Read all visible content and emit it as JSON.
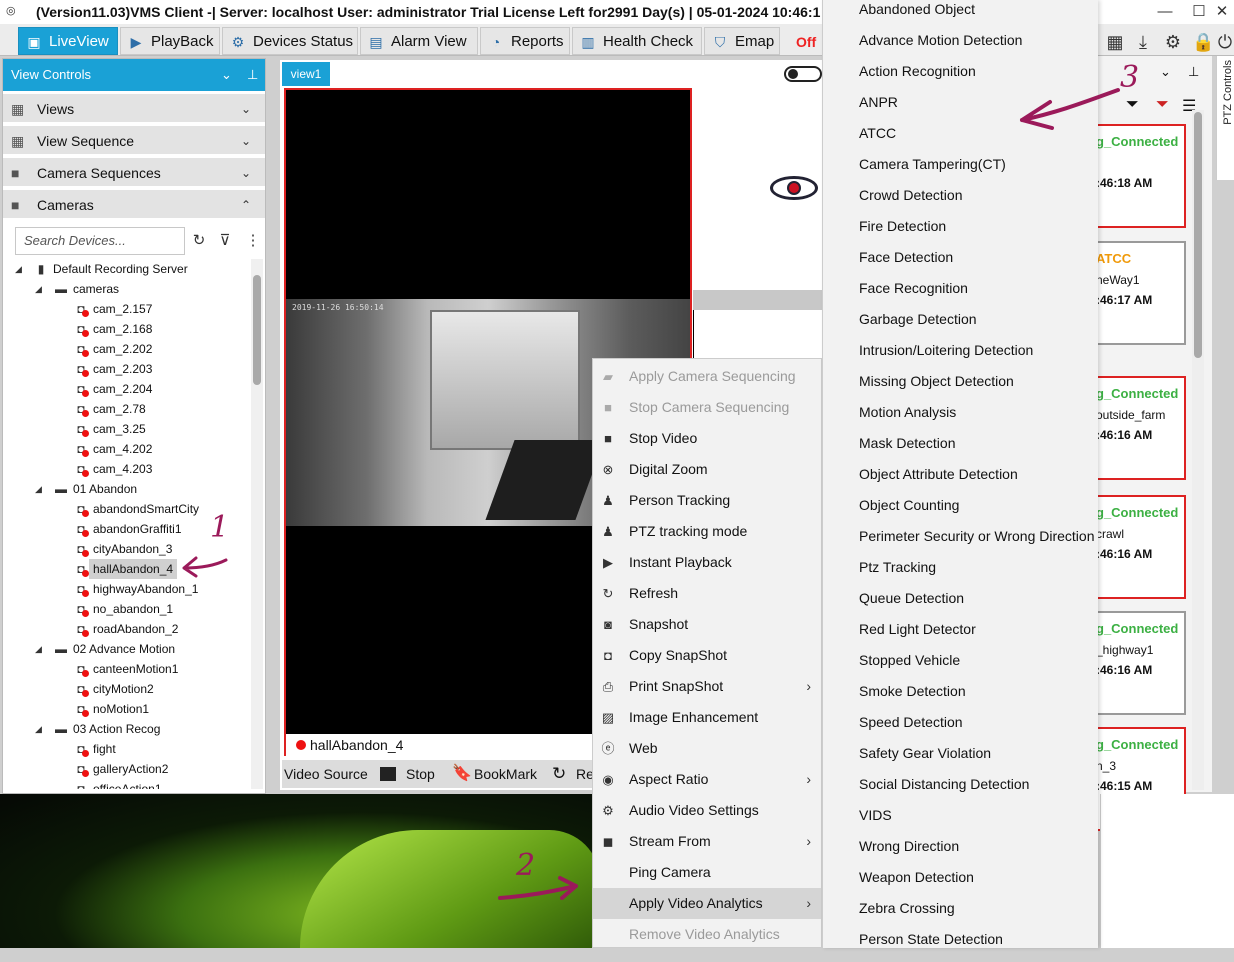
{
  "titlebar": {
    "title": "(Version11.03)VMS Client -| Server: localhost  User: administrator  Trial License Left for2991 Day(s) | 05-01-2024 10:46:1",
    "minimize": "—",
    "maximize": "☐",
    "close": "✕"
  },
  "tabs": [
    {
      "label": "LiveView"
    },
    {
      "label": "PlayBack"
    },
    {
      "label": "Devices Status"
    },
    {
      "label": "Alarm View"
    },
    {
      "label": "Reports"
    },
    {
      "label": "Health Check"
    },
    {
      "label": "Emap"
    }
  ],
  "offline_label": "Off",
  "left_panel": {
    "header": "View Controls",
    "pin": "⊥",
    "accordions": [
      {
        "label": "Views",
        "chevron": "⌄"
      },
      {
        "label": "View Sequence",
        "chevron": "⌄"
      },
      {
        "label": "Camera Sequences",
        "chevron": "⌄"
      },
      {
        "label": "Cameras",
        "chevron": "⌃"
      }
    ],
    "search_placeholder": "Search Devices...",
    "tree": {
      "server": "Default Recording Server",
      "groups": [
        {
          "label": "cameras",
          "items": [
            "cam_2.157",
            "cam_2.168",
            "cam_2.202",
            "cam_2.203",
            "cam_2.204",
            "cam_2.78",
            "cam_3.25",
            "cam_4.202",
            "cam_4.203"
          ]
        },
        {
          "label": "01 Abandon",
          "items": [
            "abandondSmartCity",
            "abandonGraffiti1",
            "cityAbandon_3",
            "hallAbandon_4",
            "highwayAbandon_1",
            "no_abandon_1",
            "roadAbandon_2"
          ]
        },
        {
          "label": "02 Advance Motion",
          "items": [
            "canteenMotion1",
            "cityMotion2",
            "noMotion1"
          ]
        },
        {
          "label": "03 Action Recog",
          "items": [
            "fight",
            "galleryAction2",
            "officeAction1"
          ]
        }
      ],
      "selected": "hallAbandon_4"
    }
  },
  "center": {
    "view_tab": "view1",
    "camera_label": "hallAbandon_4",
    "timestamp": "2019-11-26 16:50:14",
    "video_bar": {
      "source": "Video Source",
      "stop": "Stop",
      "bookmark": "BookMark",
      "re": "Re"
    }
  },
  "context_menu": [
    {
      "label": "Apply Camera Sequencing",
      "icon": "camera-sequence-icon",
      "disabled": true
    },
    {
      "label": "Stop Camera Sequencing",
      "icon": "stop-square-icon",
      "disabled": true
    },
    {
      "label": "Stop Video",
      "icon": "stop-square-icon"
    },
    {
      "label": "Digital Zoom",
      "icon": "zoom-icon"
    },
    {
      "label": "Person Tracking",
      "icon": "person-search-icon"
    },
    {
      "label": "PTZ tracking mode",
      "icon": "person-search-icon"
    },
    {
      "label": "Instant Playback",
      "icon": "play-icon"
    },
    {
      "label": "Refresh",
      "icon": "refresh-icon"
    },
    {
      "label": "Snapshot",
      "icon": "camera-icon"
    },
    {
      "label": "Copy SnapShot",
      "icon": "copy-camera-icon"
    },
    {
      "label": "Print SnapShot",
      "icon": "printer-icon",
      "submenu": true
    },
    {
      "label": "Image Enhancement",
      "icon": "image-icon"
    },
    {
      "label": "Web",
      "icon": "web-icon"
    },
    {
      "label": "Aspect Ratio",
      "icon": "aspect-ratio-icon",
      "submenu": true
    },
    {
      "label": "Audio Video Settings",
      "icon": "gear-icon"
    },
    {
      "label": "Stream From",
      "icon": "video-camera-icon",
      "submenu": true
    },
    {
      "label": "Ping Camera",
      "icon": ""
    },
    {
      "label": "Apply Video Analytics",
      "icon": "",
      "submenu": true,
      "highlighted": true
    },
    {
      "label": "Remove Video Analytics",
      "icon": "",
      "disabled": true
    }
  ],
  "analytics_submenu": [
    "Abandoned Object",
    "Advance Motion Detection",
    "Action Recognition",
    "ANPR",
    "ATCC",
    "Camera Tampering(CT)",
    "Crowd Detection",
    "Fire Detection",
    "Face Detection",
    "Face Recognition",
    "Garbage Detection",
    "Intrusion/Loitering Detection",
    "Missing Object Detection",
    "Motion Analysis",
    "Mask Detection",
    "Object Attribute Detection",
    "Object Counting",
    "Perimeter Security or Wrong Direction",
    "Ptz Tracking",
    "Queue Detection",
    "Red Light Detector",
    "Stopped Vehicle",
    "Smoke Detection",
    "Speed Detection",
    "Safety Gear Violation",
    "Social Distancing Detection",
    "VIDS",
    "Wrong Direction",
    "Weapon Detection",
    "Zebra Crossing",
    "Person State Detection"
  ],
  "right_panel": {
    "ptz_label": "PTZ Controls",
    "status_cards": [
      {
        "line1": "g_Connected",
        "line2": "",
        "line3": ":46:18 AM",
        "style": "red",
        "color": "#3cb043"
      },
      {
        "line1": "ATCC",
        "line2": "neWay1",
        "line3": ":46:17 AM",
        "style": "gray",
        "color": "#f09a0a"
      },
      {
        "line1": "g_Connected",
        "line2": "outside_farm",
        "line3": ":46:16 AM",
        "style": "red",
        "color": "#3cb043"
      },
      {
        "line1": "g_Connected",
        "line2": "crawl",
        "line3": ":46:16 AM",
        "style": "red",
        "color": "#3cb043"
      },
      {
        "line1": "g_Connected",
        "line2": "_highway1",
        "line3": ":46:16 AM",
        "style": "gray",
        "color": "#3cb043"
      },
      {
        "line1": "g_Connected",
        "line2": "n_3",
        "line3": ":46:15 AM",
        "style": "red",
        "color": "#3cb043"
      }
    ]
  },
  "annotations": [
    "1",
    "2",
    "3"
  ],
  "colors": {
    "accent": "#1aa1d6",
    "alert": "#e11111",
    "connected": "#3cb043",
    "annotation": "#9b1a5a"
  }
}
